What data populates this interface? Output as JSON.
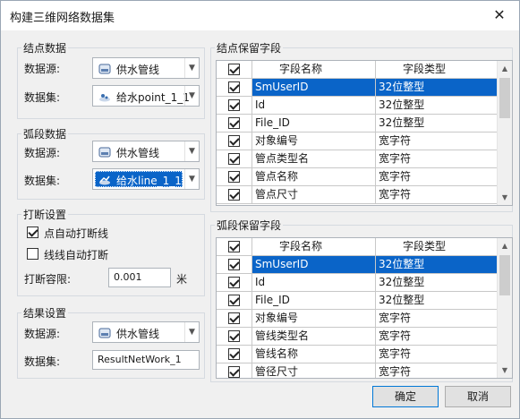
{
  "dialog": {
    "title": "构建三维网络数据集",
    "close_glyph": "✕"
  },
  "node_data": {
    "legend": "结点数据",
    "datasource_label": "数据源:",
    "datasource_value": "供水管线",
    "dataset_label": "数据集:",
    "dataset_value": "给水point_1_1"
  },
  "arc_data": {
    "legend": "弧段数据",
    "datasource_label": "数据源:",
    "datasource_value": "供水管线",
    "dataset_label": "数据集:",
    "dataset_value": "给水line_1_1"
  },
  "break_settings": {
    "legend": "打断设置",
    "auto_break_point_label": "点自动打断线",
    "auto_break_point_checked": true,
    "auto_break_line_label": "线线自动打断",
    "auto_break_line_checked": false,
    "tolerance_label": "打断容限:",
    "tolerance_value": "0.001",
    "tolerance_unit": "米"
  },
  "result_settings": {
    "legend": "结果设置",
    "datasource_label": "数据源:",
    "datasource_value": "供水管线",
    "dataset_label": "数据集:",
    "dataset_value": "ResultNetWork_1"
  },
  "node_fields": {
    "legend": "结点保留字段",
    "header": {
      "name": "字段名称",
      "type": "字段类型"
    },
    "rows": [
      {
        "checked": true,
        "name": "SmUserID",
        "type": "32位整型",
        "selected": true
      },
      {
        "checked": true,
        "name": "Id",
        "type": "32位整型",
        "selected": false
      },
      {
        "checked": true,
        "name": "File_ID",
        "type": "32位整型",
        "selected": false
      },
      {
        "checked": true,
        "name": "对象编号",
        "type": "宽字符",
        "selected": false
      },
      {
        "checked": true,
        "name": "管点类型名",
        "type": "宽字符",
        "selected": false
      },
      {
        "checked": true,
        "name": "管点名称",
        "type": "宽字符",
        "selected": false
      },
      {
        "checked": true,
        "name": "管点尺寸",
        "type": "宽字符",
        "selected": false
      }
    ]
  },
  "arc_fields": {
    "legend": "弧段保留字段",
    "header": {
      "name": "字段名称",
      "type": "字段类型"
    },
    "rows": [
      {
        "checked": true,
        "name": "SmUserID",
        "type": "32位整型",
        "selected": true
      },
      {
        "checked": true,
        "name": "Id",
        "type": "32位整型",
        "selected": false
      },
      {
        "checked": true,
        "name": "File_ID",
        "type": "32位整型",
        "selected": false
      },
      {
        "checked": true,
        "name": "对象编号",
        "type": "宽字符",
        "selected": false
      },
      {
        "checked": true,
        "name": "管线类型名",
        "type": "宽字符",
        "selected": false
      },
      {
        "checked": true,
        "name": "管线名称",
        "type": "宽字符",
        "selected": false
      },
      {
        "checked": true,
        "name": "管径尺寸",
        "type": "宽字符",
        "selected": false
      }
    ]
  },
  "buttons": {
    "ok": "确定",
    "cancel": "取消"
  },
  "colors": {
    "selection": "#0a64c8",
    "dialog_bg": "#f0f0f0"
  }
}
